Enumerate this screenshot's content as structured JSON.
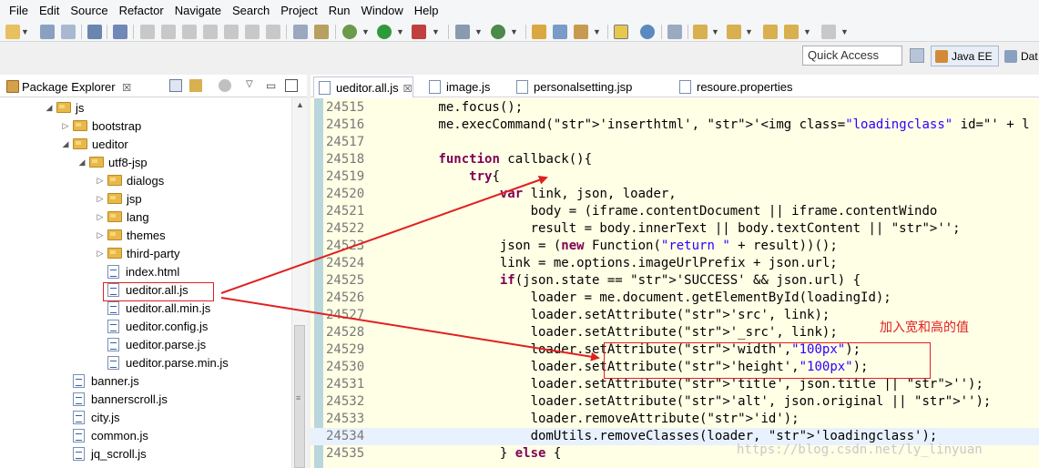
{
  "menu": [
    "File",
    "Edit",
    "Source",
    "Refactor",
    "Navigate",
    "Search",
    "Project",
    "Run",
    "Window",
    "Help"
  ],
  "toolbar": {
    "quick_access_placeholder": "Quick Access",
    "perspective_java_ee": "Java EE",
    "perspective_other": "Dat"
  },
  "package_explorer": {
    "title": "Package Explorer",
    "close": "☒",
    "tree": [
      {
        "label": "js",
        "kind": "folder",
        "depth": 0,
        "expanded": true
      },
      {
        "label": "bootstrap",
        "kind": "folder",
        "depth": 1,
        "expanded": false
      },
      {
        "label": "ueditor",
        "kind": "folder",
        "depth": 1,
        "expanded": true
      },
      {
        "label": "utf8-jsp",
        "kind": "folder",
        "depth": 2,
        "expanded": true
      },
      {
        "label": "dialogs",
        "kind": "folder",
        "depth": 3,
        "expanded": false
      },
      {
        "label": "jsp",
        "kind": "folder",
        "depth": 3,
        "expanded": false
      },
      {
        "label": "lang",
        "kind": "folder",
        "depth": 3,
        "expanded": false
      },
      {
        "label": "themes",
        "kind": "folder",
        "depth": 3,
        "expanded": false
      },
      {
        "label": "third-party",
        "kind": "folder",
        "depth": 3,
        "expanded": false
      },
      {
        "label": "index.html",
        "kind": "file",
        "depth": 3
      },
      {
        "label": "ueditor.all.js",
        "kind": "file",
        "depth": 3
      },
      {
        "label": "ueditor.all.min.js",
        "kind": "file",
        "depth": 3
      },
      {
        "label": "ueditor.config.js",
        "kind": "file",
        "depth": 3
      },
      {
        "label": "ueditor.parse.js",
        "kind": "file",
        "depth": 3
      },
      {
        "label": "ueditor.parse.min.js",
        "kind": "file",
        "depth": 3
      },
      {
        "label": "banner.js",
        "kind": "file",
        "depth": 1
      },
      {
        "label": "bannerscroll.js",
        "kind": "file",
        "depth": 1
      },
      {
        "label": "city.js",
        "kind": "file",
        "depth": 1
      },
      {
        "label": "common.js",
        "kind": "file",
        "depth": 1
      },
      {
        "label": "jq_scroll.js",
        "kind": "file",
        "depth": 1
      }
    ]
  },
  "editor": {
    "tabs": [
      {
        "label": "ueditor.all.js",
        "active": true,
        "close": "☒"
      },
      {
        "label": "image.js",
        "active": false
      },
      {
        "label": "personalsetting.jsp",
        "active": false
      },
      {
        "label": "resoure.properties",
        "active": false
      }
    ],
    "lines": [
      {
        "n": "24515",
        "code": "        me.focus();"
      },
      {
        "n": "24516",
        "code": "        me.execCommand('inserthtml', '<img class=\"loadingclass\" id=\"' + l"
      },
      {
        "n": "24517",
        "code": ""
      },
      {
        "n": "24518",
        "code": "        function callback(){"
      },
      {
        "n": "24519",
        "code": "            try{"
      },
      {
        "n": "24520",
        "code": "                var link, json, loader,"
      },
      {
        "n": "24521",
        "code": "                    body = (iframe.contentDocument || iframe.contentWindo"
      },
      {
        "n": "24522",
        "code": "                    result = body.innerText || body.textContent || '';"
      },
      {
        "n": "24523",
        "code": "                json = (new Function(\"return \" + result))();"
      },
      {
        "n": "24524",
        "code": "                link = me.options.imageUrlPrefix + json.url;"
      },
      {
        "n": "24525",
        "code": "                if(json.state == 'SUCCESS' && json.url) {"
      },
      {
        "n": "24526",
        "code": "                    loader = me.document.getElementById(loadingId);"
      },
      {
        "n": "24527",
        "code": "                    loader.setAttribute('src', link);"
      },
      {
        "n": "24528",
        "code": "                    loader.setAttribute('_src', link);"
      },
      {
        "n": "24529",
        "code": "                    loader.setAttribute('width',\"100px\");"
      },
      {
        "n": "24530",
        "code": "                    loader.setAttribute('height',\"100px\");"
      },
      {
        "n": "24531",
        "code": "                    loader.setAttribute('title', json.title || '');"
      },
      {
        "n": "24532",
        "code": "                    loader.setAttribute('alt', json.original || '');"
      },
      {
        "n": "24533",
        "code": "                    loader.removeAttribute('id');"
      },
      {
        "n": "24534",
        "code": "                    domUtils.removeClasses(loader, 'loadingclass');"
      },
      {
        "n": "24535",
        "code": "                } else {"
      }
    ]
  },
  "annotation": {
    "note": "加入宽和高的值",
    "color": "#e02020"
  },
  "watermark": "https://blog.csdn.net/ly_linyuan"
}
